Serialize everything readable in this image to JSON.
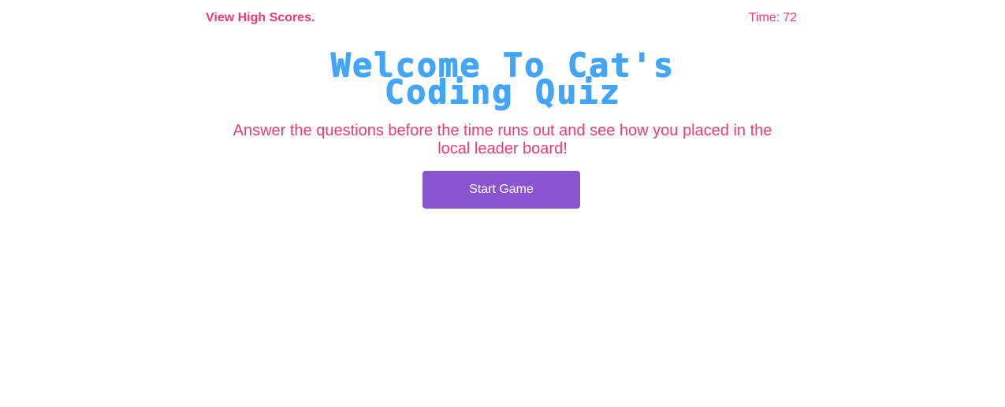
{
  "header": {
    "high_scores_label": "View High Scores.",
    "timer_label": "Time:",
    "timer_value": "72"
  },
  "main": {
    "title_line1": "Welcome To Cat's",
    "title_line2": "Coding Quiz",
    "intro_text": "Answer the questions before the time runs out and see how you placed in the local leader board!",
    "start_button_label": "Start Game"
  },
  "colors": {
    "accent_pink": "#ee3a73",
    "title_blue": "#42a5f5",
    "button_purple": "#8a56d0",
    "background": "#ffffff"
  }
}
